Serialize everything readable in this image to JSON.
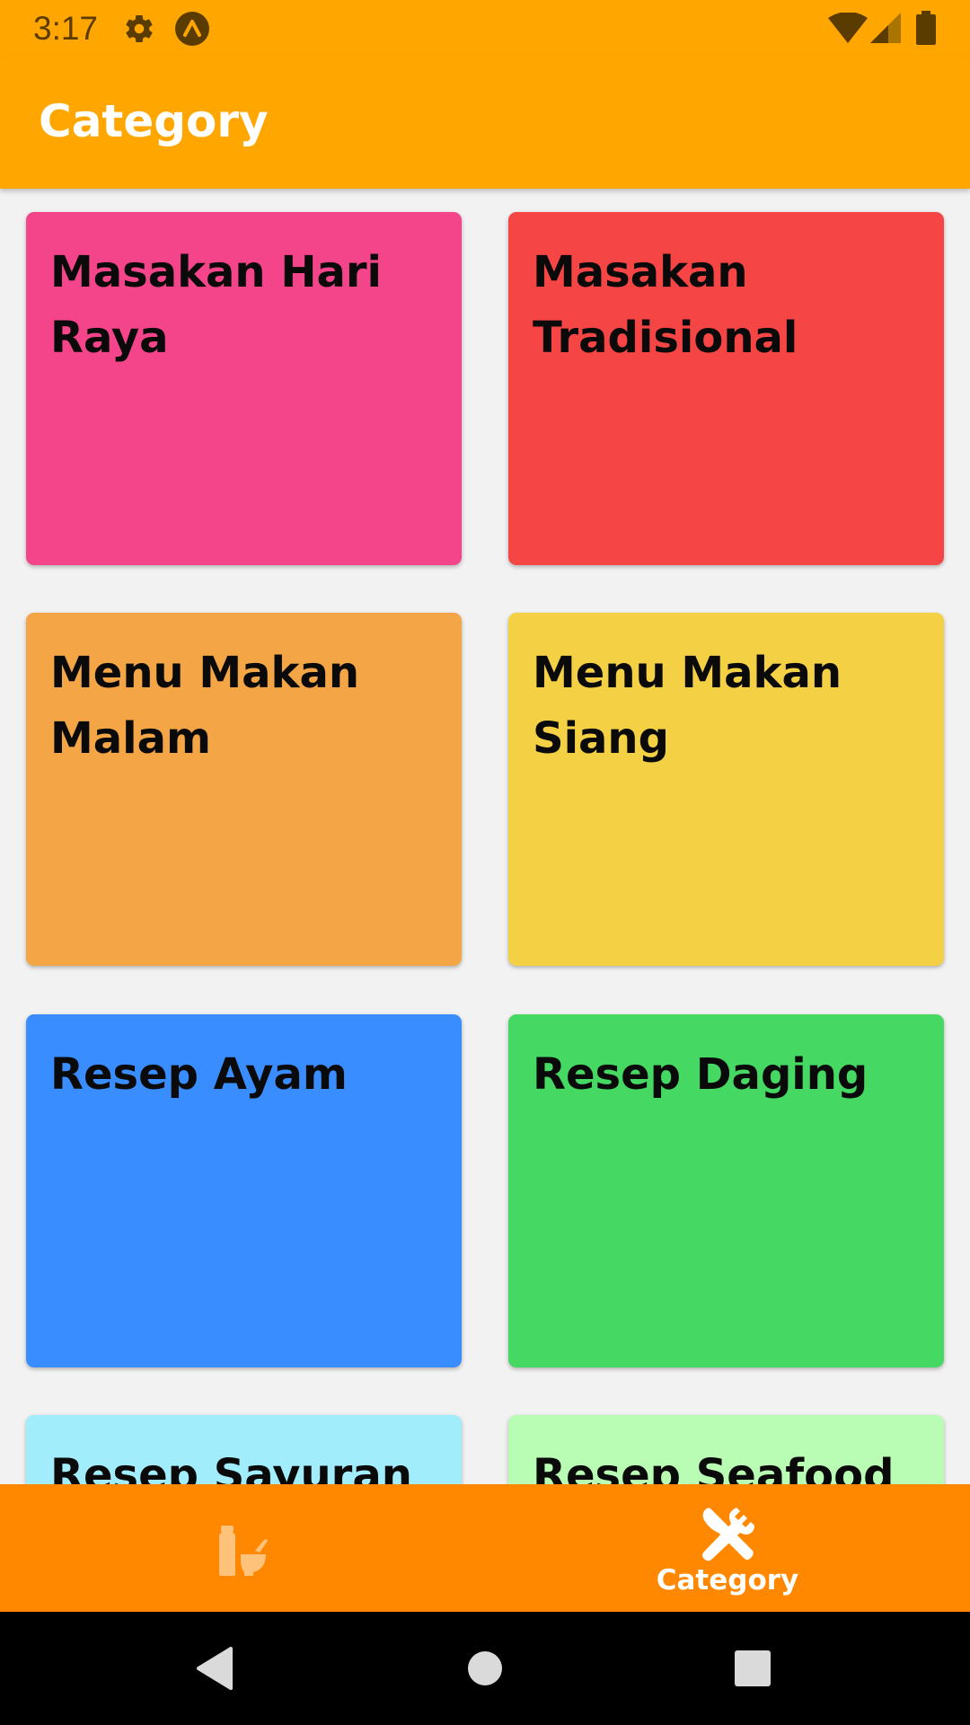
{
  "status_bar": {
    "time": "3:17",
    "icons": [
      "settings-gear-icon",
      "vpn-lambda-icon",
      "wifi-icon",
      "cellular-signal-icon",
      "battery-icon"
    ]
  },
  "app_bar": {
    "title": "Category"
  },
  "categories": [
    {
      "label": "Masakan Hari Raya",
      "color": "#F5458A"
    },
    {
      "label": "Masakan Tradisional",
      "color": "#F64545"
    },
    {
      "label": "Menu Makan Malam",
      "color": "#F4A545"
    },
    {
      "label": "Menu Makan Siang",
      "color": "#F4D045"
    },
    {
      "label": "Resep Ayam",
      "color": "#3A8DFF"
    },
    {
      "label": "Resep Daging",
      "color": "#45D862"
    },
    {
      "label": "Resep Sayuran",
      "color": "#A2EDFC"
    },
    {
      "label": "Resep Seafood",
      "color": "#B9FCB3"
    }
  ],
  "bottom_nav": {
    "items": [
      {
        "icon": "mortar-pestle-icon",
        "label": "",
        "selected": false
      },
      {
        "icon": "fork-knife-icon",
        "label": "Category",
        "selected": true
      }
    ],
    "background": "#FF8800"
  },
  "system_nav": {
    "icons": [
      "back-icon",
      "home-icon",
      "recents-icon"
    ]
  },
  "colors": {
    "primary": "#FFA700",
    "accent": "#FF8800",
    "background": "#F2F2F2"
  }
}
